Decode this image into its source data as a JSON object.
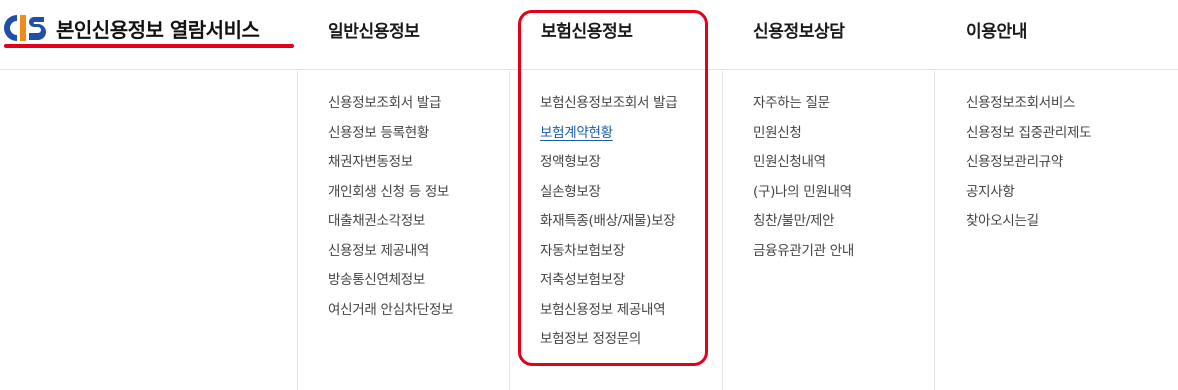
{
  "header": {
    "site_title": "본인신용정보 열람서비스",
    "logo_letters": "CIS"
  },
  "brand_colors": {
    "blue": "#1f4fa8",
    "orange": "#f28a1c",
    "red": "#e3001b"
  },
  "menu": [
    {
      "title": "일반신용정보",
      "items": [
        "신용정보조회서 발급",
        "신용정보 등록현황",
        "채권자변동정보",
        "개인회생 신청 등 정보",
        "대출채권소각정보",
        "신용정보 제공내역",
        "방송통신연체정보",
        "여신거래 안심차단정보"
      ]
    },
    {
      "title": "보험신용정보",
      "items": [
        "보험신용정보조회서 발급",
        "보험계약현황",
        "정액형보장",
        "실손형보장",
        "화재특종(배상/재물)보장",
        "자동차보험보장",
        "저축성보험보장",
        "보험신용정보 제공내역",
        "보험정보 정정문의"
      ],
      "active_item": "보험계약현황"
    },
    {
      "title": "신용정보상담",
      "items": [
        "자주하는 질문",
        "민원신청",
        "민원신청내역",
        "(구)나의 민원내역",
        "칭찬/불만/제안",
        "금융유관기관 안내"
      ]
    },
    {
      "title": "이용안내",
      "items": [
        "신용정보조회서비스",
        "신용정보 집중관리제도",
        "신용정보관리규약",
        "공지사항",
        "찾아오시는길"
      ]
    }
  ]
}
